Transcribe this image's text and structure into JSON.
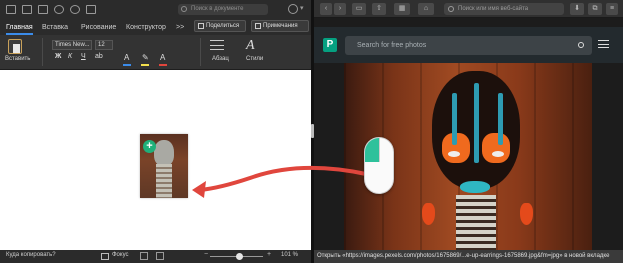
{
  "word": {
    "search_placeholder": "Поиск в документе",
    "tabs": [
      "Главная",
      "Вставка",
      "Рисование",
      "Конструктор",
      ">>"
    ],
    "share_label": "Поделиться",
    "notes_label": "Примечания",
    "paste_label": "Вставить",
    "font_name": "Times New...",
    "font_size": "12",
    "paragraph_label": "Абзац",
    "styles_label": "Стили",
    "format_buttons": [
      "Ж",
      "К",
      "Ч"
    ],
    "status_text": "Куда копировать?",
    "focus_label": "Фокус",
    "zoom_value": "101 %",
    "accent_color": "#3b8cea"
  },
  "safari": {
    "address_placeholder": "Поиск или имя веб-сайта",
    "link_status": "Открыть «https://images.pexels.com/photos/1675869/...e-up-earrings-1675869.jpg&fm=jpg» в новой вкладке"
  },
  "pexels": {
    "logo": "P",
    "search_placeholder": "Search for free photos",
    "brand_color": "#05a081"
  },
  "drag": {
    "arrow_color": "#e0463d",
    "mouse_button_color": "#2ec19b"
  }
}
